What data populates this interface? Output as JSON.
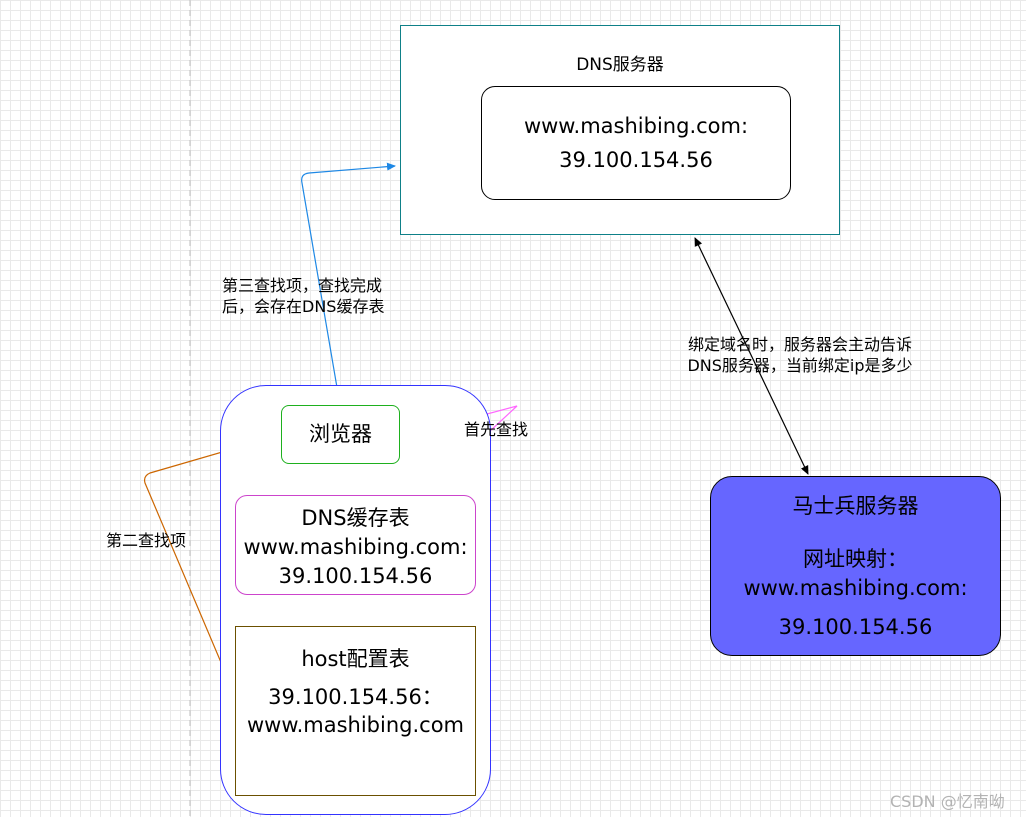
{
  "dns_server": {
    "title": "DNS服务器",
    "record_domain": "www.mashibing.com:",
    "record_ip": "39.100.154.56"
  },
  "browser": {
    "label": "浏览器"
  },
  "dns_cache": {
    "title": "DNS缓存表",
    "domain": "www.mashibing.com:",
    "ip": "39.100.154.56"
  },
  "host_config": {
    "title": "host配置表",
    "ip": "39.100.154.56：",
    "domain": "www.mashibing.com"
  },
  "mashibing_server": {
    "title": "马士兵服务器",
    "mapping_label": "网址映射：",
    "domain": "www.mashibing.com:",
    "ip": "39.100.154.56"
  },
  "edge_labels": {
    "third_lookup_line1": "第三查找项，查找完成",
    "third_lookup_line2": "后，会存在DNS缓存表",
    "first_lookup": "首先查找",
    "second_lookup": "第二查找项",
    "bind_line1": "绑定域名时，服务器会主动告诉",
    "bind_line2": "DNS服务器，当前绑定ip是多少"
  },
  "colors": {
    "dns_server_border": "#0e8088",
    "browser_border": "#1eb01e",
    "container_border": "#3333ff",
    "dns_cache_border": "#cc44cc",
    "host_border": "#6b5000",
    "mashibing_fill": "#6666ff",
    "edge_third": "#1e88e5",
    "edge_first": "#ff66ff",
    "edge_second": "#cc6600",
    "edge_bind": "#000000"
  },
  "watermark": "CSDN @忆南呦"
}
